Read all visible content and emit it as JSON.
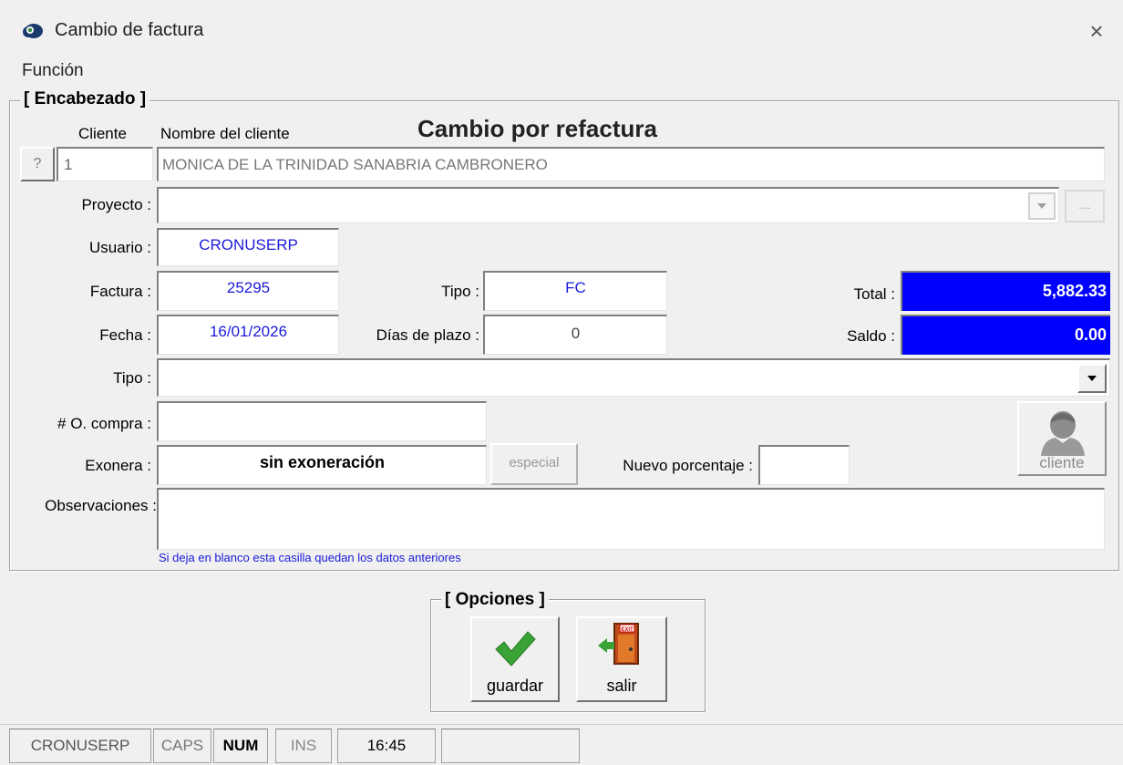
{
  "window": {
    "title": "Cambio de factura",
    "close_glyph": "×"
  },
  "menu": {
    "items": [
      "Función"
    ]
  },
  "header_group": {
    "title": "[ Encabezado ]",
    "heading": "Cambio por refactura",
    "cliente_label": "Cliente",
    "nombre_label": "Nombre del cliente",
    "lookup_button": "?",
    "cliente_code": "1",
    "cliente_name": "MONICA DE LA TRINIDAD SANABRIA CAMBRONERO",
    "proyecto_label": "Proyecto :",
    "proyecto_value": "",
    "proyecto_more_button": "....",
    "usuario_label": "Usuario :",
    "usuario_value": "CRONUSERP",
    "factura_label": "Factura :",
    "factura_value": "25295",
    "tipo_label": "Tipo :",
    "tipo_value": "FC",
    "total_label": "Total :",
    "total_value": "5,882.33",
    "fecha_label": "Fecha :",
    "fecha_value": "16/01/2026",
    "dias_label": "Días de plazo :",
    "dias_value": "0",
    "saldo_label": "Saldo :",
    "saldo_value": "0.00",
    "tipo2_label": "Tipo :",
    "tipo2_value": "",
    "orden_label": "# O. compra :",
    "orden_value": "",
    "exonera_label": "Exonera :",
    "exonera_value": "sin exoneración",
    "especial_button": "especial",
    "nuevo_porcentaje_label": "Nuevo porcentaje :",
    "nuevo_porcentaje_value": "",
    "cliente_button": "cliente",
    "observaciones_label": "Observaciones :",
    "observaciones_value": "",
    "hint": "Si deja en blanco esta casilla quedan los datos anteriores"
  },
  "options_group": {
    "title": "[ Opciones ]",
    "guardar": "guardar",
    "salir": "salir",
    "exit_sign": "EXIT"
  },
  "status_bar": [
    "CRONUSERP",
    "CAPS",
    "NUM",
    "INS",
    "16:45",
    ""
  ],
  "colors": {
    "accent_blue": "#0000ff",
    "text_blue": "#1a1adb",
    "check_green": "#3aa336"
  }
}
